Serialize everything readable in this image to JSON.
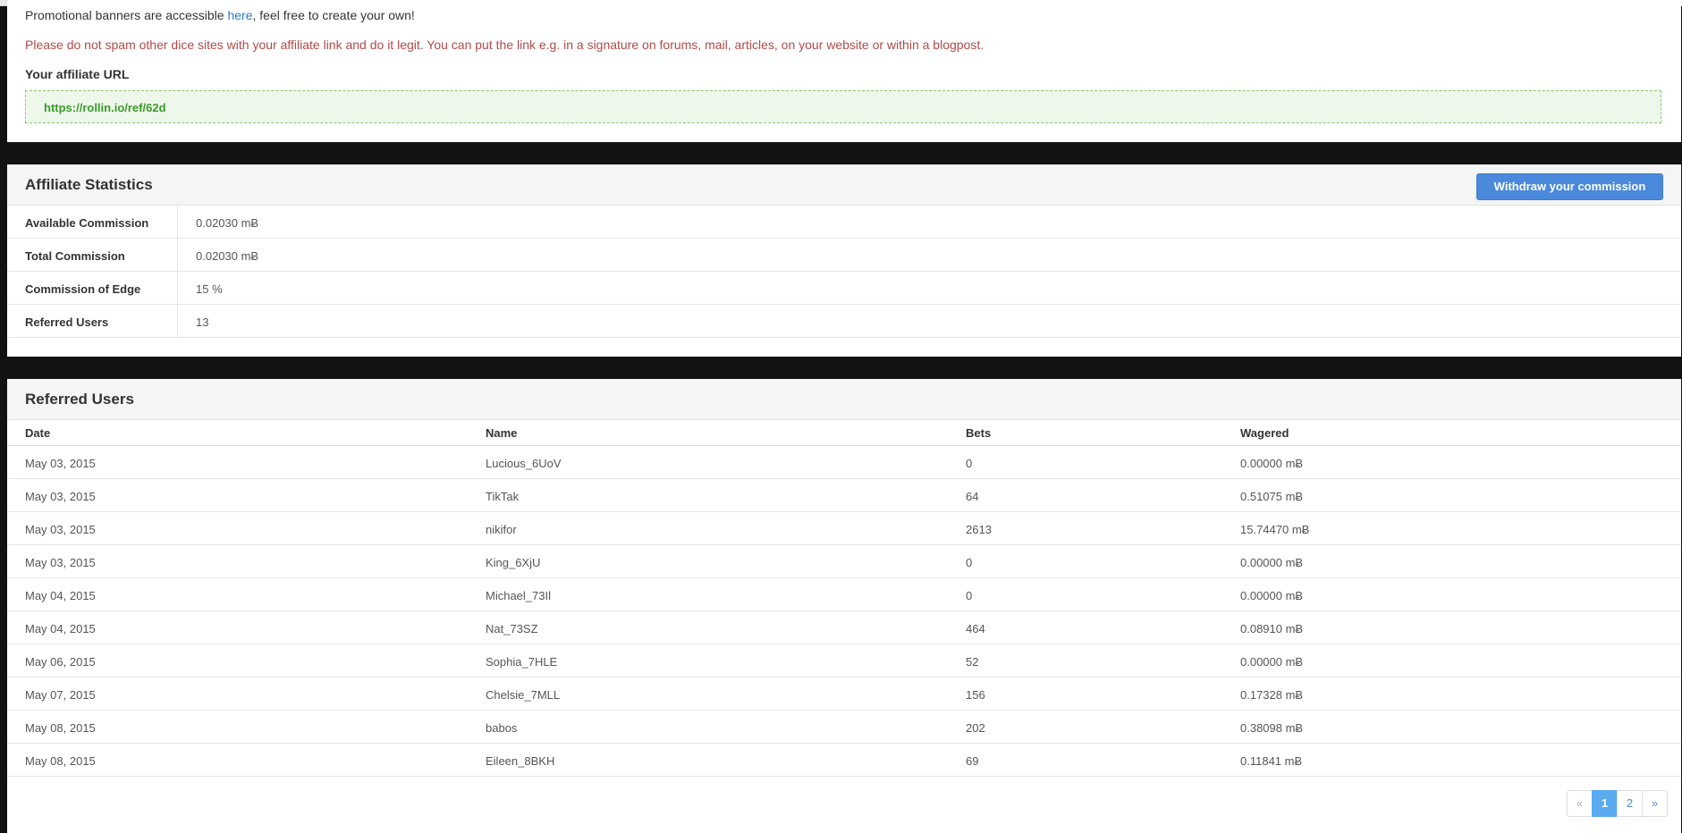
{
  "intro": {
    "promo_before": "Promotional banners are accessible ",
    "promo_link": "here",
    "promo_after": ", feel free to create your own!",
    "warning": "Please do not spam other dice sites with your affiliate link and do it legit. You can put the link e.g. in a signature on forums, mail, articles, on your website or within a blogpost.",
    "url_label": "Your affiliate URL",
    "url": "https://rollin.io/ref/62d"
  },
  "stats": {
    "title": "Affiliate Statistics",
    "withdraw_label": "Withdraw your commission",
    "rows": [
      {
        "key": "Available Commission",
        "value": "0.02030 mɃ"
      },
      {
        "key": "Total Commission",
        "value": "0.02030 mɃ"
      },
      {
        "key": "Commission of Edge",
        "value": "15 %"
      },
      {
        "key": "Referred Users",
        "value": "13"
      }
    ]
  },
  "referred": {
    "title": "Referred Users",
    "columns": [
      "Date",
      "Name",
      "Bets",
      "Wagered"
    ],
    "rows": [
      [
        "May 03, 2015",
        "Lucious_6UoV",
        "0",
        "0.00000 mɃ"
      ],
      [
        "May 03, 2015",
        "TikTak",
        "64",
        "0.51075 mɃ"
      ],
      [
        "May 03, 2015",
        "nikifor",
        "2613",
        "15.74470 mɃ"
      ],
      [
        "May 03, 2015",
        "King_6XjU",
        "0",
        "0.00000 mɃ"
      ],
      [
        "May 04, 2015",
        "Michael_73Il",
        "0",
        "0.00000 mɃ"
      ],
      [
        "May 04, 2015",
        "Nat_73SZ",
        "464",
        "0.08910 mɃ"
      ],
      [
        "May 06, 2015",
        "Sophia_7HLE",
        "52",
        "0.00000 mɃ"
      ],
      [
        "May 07, 2015",
        "Chelsie_7MLL",
        "156",
        "0.17328 mɃ"
      ],
      [
        "May 08, 2015",
        "babos",
        "202",
        "0.38098 mɃ"
      ],
      [
        "May 08, 2015",
        "Eileen_8BKH",
        "69",
        "0.11841 mɃ"
      ]
    ],
    "pagination": {
      "prev": "«",
      "pages": [
        "1",
        "2"
      ],
      "active": "1",
      "next": "»"
    }
  }
}
